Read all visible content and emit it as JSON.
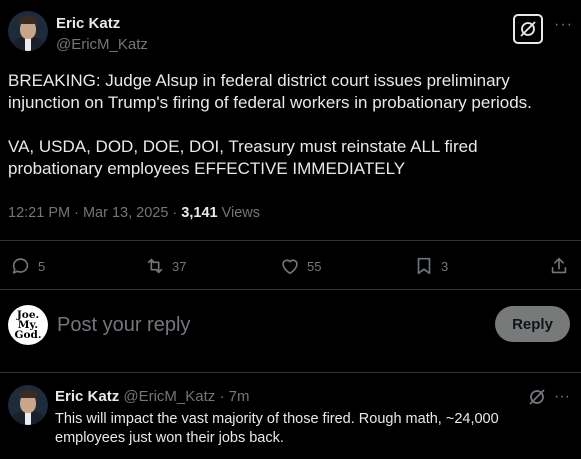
{
  "tweet": {
    "author_name": "Eric Katz",
    "author_handle": "@EricM_Katz",
    "text": "BREAKING: Judge Alsup in federal district court issues preliminary injunction on Trump's firing of federal workers in probationary periods.\n\nVA, USDA, DOD, DOE, DOI, Treasury must reinstate ALL fired probationary employees EFFECTIVE IMMEDIATELY",
    "time": "12:21 PM · Mar 13, 2025 · ",
    "views_count": "3,141",
    "views_label": " Views"
  },
  "actions": {
    "replies": "5",
    "reposts": "37",
    "likes": "55",
    "bookmarks": "3"
  },
  "composer": {
    "avatar_lines": [
      "Joe.",
      "My.",
      "God."
    ],
    "placeholder": "Post your reply",
    "reply_button": "Reply"
  },
  "reply": {
    "author_name": "Eric Katz",
    "author_handle": "@EricM_Katz",
    "time": "· 7m",
    "text": "This will impact the vast majority of those fired. Rough math, ~24,000 employees just won their jobs back."
  },
  "colors": {
    "background": "#000000",
    "text": "#e7e9ea",
    "muted": "#71767b",
    "divider": "#2f3336",
    "reply_button_bg": "#787a7a"
  },
  "icons": {
    "grok": "grok-icon",
    "more": "more-icon",
    "reply": "reply-icon",
    "repost": "repost-icon",
    "like": "heart-icon",
    "bookmark": "bookmark-icon",
    "share": "share-icon"
  }
}
